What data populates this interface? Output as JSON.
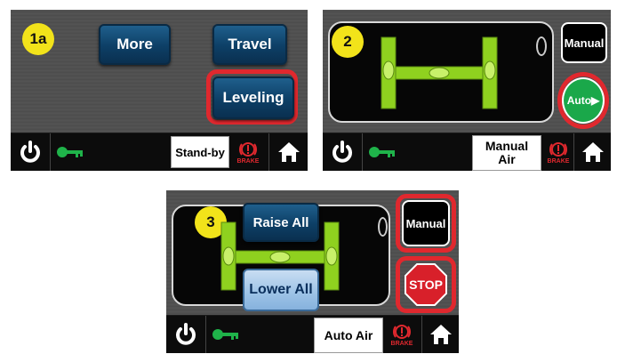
{
  "screen1": {
    "badge": "1a",
    "more_label": "More",
    "travel_label": "Travel",
    "leveling_label": "Leveling",
    "status": "Stand-by",
    "brake_label": "BRAKE"
  },
  "screen2": {
    "badge": "2",
    "manual_label": "Manual",
    "auto_label": "Auto▶",
    "status_line1": "Manual",
    "status_line2": "Air",
    "brake_label": "BRAKE"
  },
  "screen3": {
    "badge": "3",
    "raise_label": "Raise All",
    "lower_label": "Lower All",
    "manual_label": "Manual",
    "stop_label": "STOP",
    "status": "Auto Air",
    "brake_label": "BRAKE"
  },
  "icons": [
    "power-icon",
    "key-icon",
    "brake-icon",
    "home-icon"
  ],
  "colors": {
    "highlight": "#e0282e",
    "auto": "#1aa84a",
    "stop": "#d8202a",
    "badge": "#f2e31a",
    "level_green": "#8fd11f"
  }
}
